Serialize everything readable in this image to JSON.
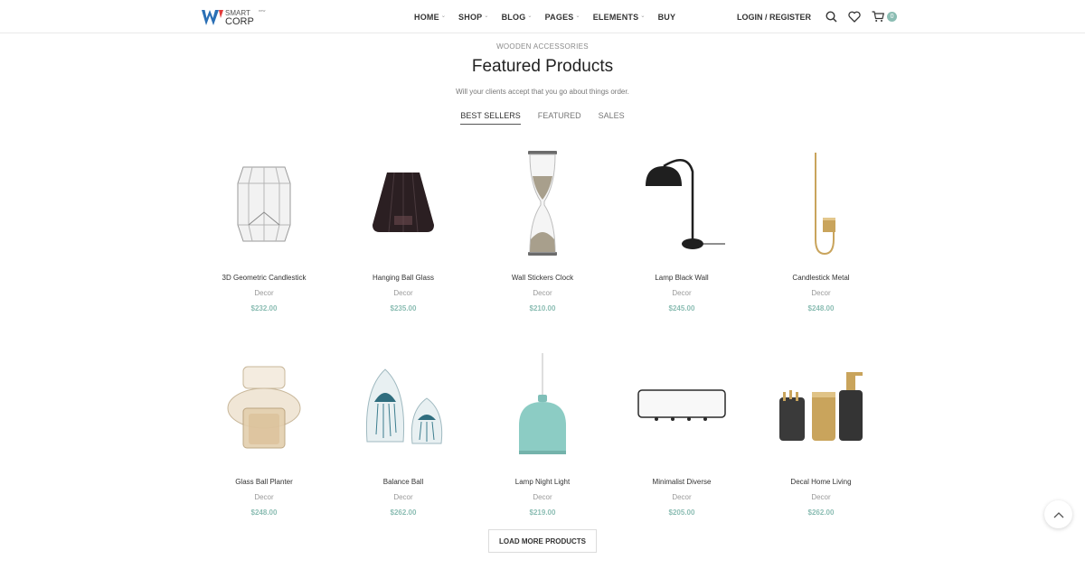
{
  "brand": {
    "logo_text_top": "SMART",
    "logo_text_bottom": "CORP",
    "logo_sup": "new"
  },
  "nav": {
    "items": [
      {
        "label": "HOME"
      },
      {
        "label": "SHOP"
      },
      {
        "label": "BLOG"
      },
      {
        "label": "PAGES"
      },
      {
        "label": "ELEMENTS"
      },
      {
        "label": "BUY"
      }
    ],
    "login_label": "LOGIN / REGISTER",
    "cart_count": "0"
  },
  "section": {
    "subtitle": "WOODEN ACCESSORIES",
    "title": "Featured Products",
    "description": "Will your clients accept that you go about things order.",
    "tabs": [
      {
        "label": "BEST SELLERS"
      },
      {
        "label": "FEATURED"
      },
      {
        "label": "SALES"
      }
    ]
  },
  "products": [
    {
      "name": "3D Geometric Candlestick",
      "category": "Decor",
      "price": "$232.00",
      "icon": "glass-candle-holder"
    },
    {
      "name": "Hanging Ball Glass",
      "category": "Decor",
      "price": "$235.00",
      "icon": "tealight-glass"
    },
    {
      "name": "Wall Stickers Clock",
      "category": "Decor",
      "price": "$210.00",
      "icon": "hourglass"
    },
    {
      "name": "Lamp Black Wall",
      "category": "Decor",
      "price": "$245.00",
      "icon": "desk-lamp"
    },
    {
      "name": "Candlestick Metal",
      "category": "Decor",
      "price": "$248.00",
      "icon": "wall-candle-holder"
    },
    {
      "name": "Glass Ball Planter",
      "category": "Decor",
      "price": "$248.00",
      "icon": "glass-planter"
    },
    {
      "name": "Balance Ball",
      "category": "Decor",
      "price": "$262.00",
      "icon": "jellyfish-paperweight"
    },
    {
      "name": "Lamp Night Light",
      "category": "Decor",
      "price": "$219.00",
      "icon": "pendant-lamp"
    },
    {
      "name": "Minimalist Diverse",
      "category": "Decor",
      "price": "$205.00",
      "icon": "mirror-hook-rack"
    },
    {
      "name": "Decal Home Living",
      "category": "Decor",
      "price": "$262.00",
      "icon": "soap-dispenser-set"
    }
  ],
  "load_more_label": "LOAD MORE PRODUCTS",
  "colors": {
    "accent": "#8bbdb3",
    "text": "#333333",
    "muted": "#999999"
  }
}
